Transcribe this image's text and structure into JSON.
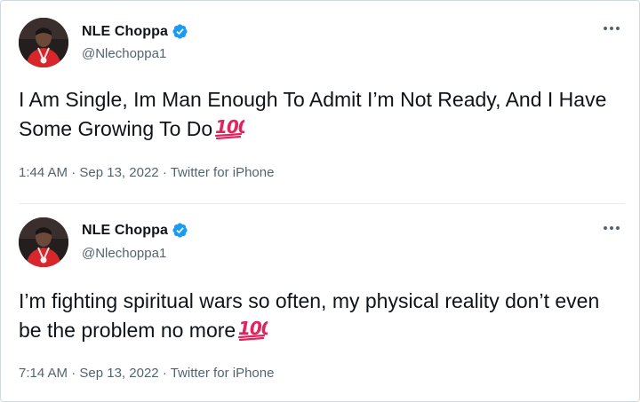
{
  "tweets": [
    {
      "name": "NLE Choppa",
      "handle": "@Nlechoppa1",
      "text": "I Am Single, Im Man Enough To Admit I’m Not Ready, And I Have Some Growing To Do",
      "emoji": "100",
      "time": "1:44 AM",
      "sep1": "·",
      "date": "Sep 13, 2022",
      "sep2": "·",
      "source": "Twitter for iPhone"
    },
    {
      "name": "NLE Choppa",
      "handle": "@Nlechoppa1",
      "text": "I’m fighting spiritual wars so often, my physical reality don’t even be the problem no more",
      "emoji": "100",
      "time": "7:14 AM",
      "sep1": "·",
      "date": "Sep 13, 2022",
      "sep2": "·",
      "source": "Twitter for iPhone"
    }
  ],
  "icons": {
    "verified": "verified-badge-icon",
    "more": "more-options-icon",
    "emoji": "hundred-points-emoji-icon"
  },
  "colors": {
    "verified": "#1d9bf0",
    "text": "#0f1419",
    "muted": "#536471",
    "emoji_red": "#e0245e"
  }
}
